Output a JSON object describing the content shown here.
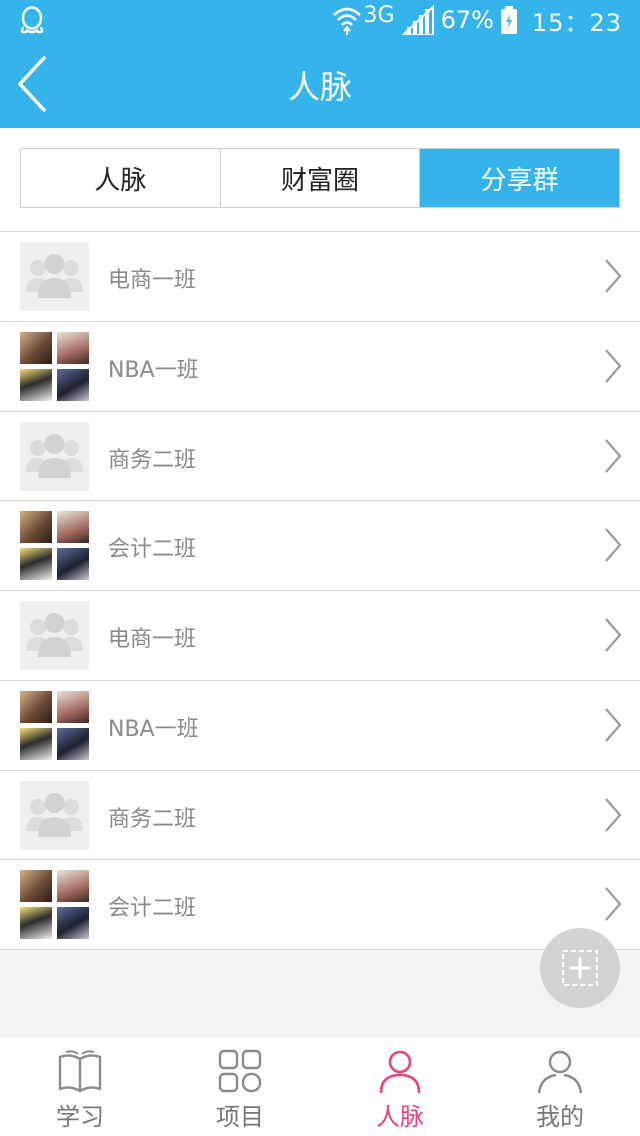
{
  "status_bar": {
    "network": "3G",
    "battery": "67%",
    "time": "15：23"
  },
  "header": {
    "title": "人脉"
  },
  "tabs": [
    {
      "label": "人脉",
      "active": false
    },
    {
      "label": "财富圈",
      "active": false
    },
    {
      "label": "分享群",
      "active": true
    }
  ],
  "groups": [
    {
      "name": "电商一班",
      "avatar": "placeholder"
    },
    {
      "name": "NBA一班",
      "avatar": "photo-grid"
    },
    {
      "name": "商务二班",
      "avatar": "placeholder"
    },
    {
      "name": "会计二班",
      "avatar": "photo-grid"
    },
    {
      "name": "电商一班",
      "avatar": "placeholder"
    },
    {
      "name": "NBA一班",
      "avatar": "photo-grid"
    },
    {
      "name": "商务二班",
      "avatar": "placeholder"
    },
    {
      "name": "会计二班",
      "avatar": "photo-grid"
    }
  ],
  "bottom_nav": [
    {
      "label": "学习",
      "icon": "book-icon",
      "active": false
    },
    {
      "label": "项目",
      "icon": "grid-icon",
      "active": false
    },
    {
      "label": "人脉",
      "icon": "person-icon",
      "active": true
    },
    {
      "label": "我的",
      "icon": "profile-icon",
      "active": false
    }
  ],
  "colors": {
    "primary": "#35b4ec",
    "active_nav": "#e8417e",
    "text_gray": "#8a8a8a"
  }
}
